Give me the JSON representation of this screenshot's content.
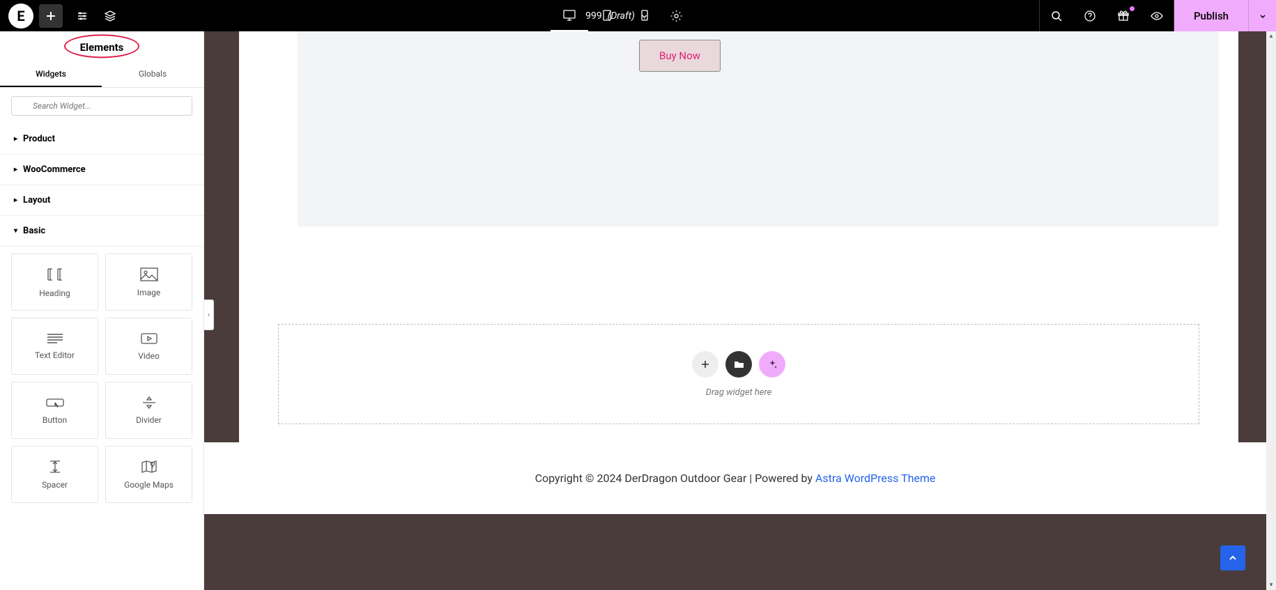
{
  "topbar": {
    "logo_letter": "E",
    "doc_title": "999",
    "doc_status": "(Draft)",
    "publish_label": "Publish"
  },
  "sidebar": {
    "panel_title": "Elements",
    "tabs": {
      "widgets": "Widgets",
      "globals": "Globals"
    },
    "search_placeholder": "Search Widget...",
    "categories": {
      "product": "Product",
      "woocommerce": "WooCommerce",
      "layout": "Layout",
      "basic": "Basic"
    },
    "widgets": {
      "heading": "Heading",
      "image": "Image",
      "text_editor": "Text Editor",
      "video": "Video",
      "button": "Button",
      "divider": "Divider",
      "spacer": "Spacer",
      "google_maps": "Google Maps"
    }
  },
  "canvas": {
    "buy_now": "Buy Now",
    "dropzone_text": "Drag widget here"
  },
  "footer": {
    "text_prefix": "Copyright © 2024 DerDragon Outdoor Gear | Powered by ",
    "link_text": "Astra WordPress Theme"
  }
}
